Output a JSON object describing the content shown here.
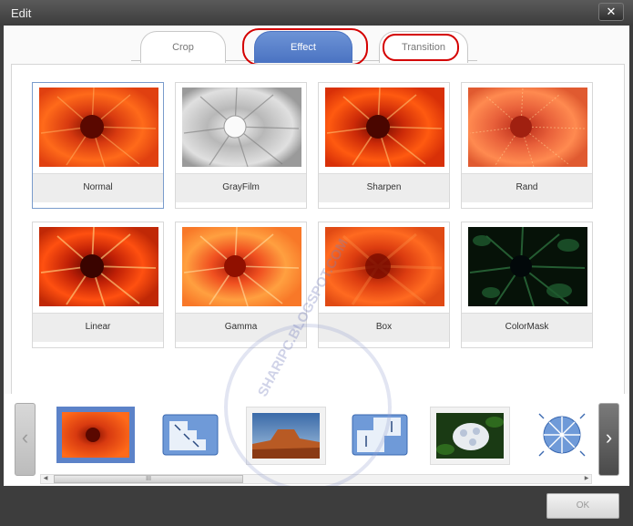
{
  "window": {
    "title": "Edit",
    "close_label": "✕"
  },
  "tabs": [
    {
      "label": "Crop",
      "active": false
    },
    {
      "label": "Effect",
      "active": true
    },
    {
      "label": "Transition",
      "active": false
    }
  ],
  "effects": [
    {
      "label": "Normal",
      "selected": true
    },
    {
      "label": "GrayFilm",
      "selected": false
    },
    {
      "label": "Sharpen",
      "selected": false
    },
    {
      "label": "Rand",
      "selected": false
    },
    {
      "label": "Linear",
      "selected": false
    },
    {
      "label": "Gamma",
      "selected": false
    },
    {
      "label": "Box",
      "selected": false
    },
    {
      "label": "ColorMask",
      "selected": false
    }
  ],
  "strip": {
    "prev_label": "‹",
    "next_label": "›",
    "scroll_grip": "III",
    "items": [
      "flower-photo",
      "transition-icon",
      "desert-photo",
      "transition-icon",
      "hydrangea-photo",
      "transition-icon"
    ]
  },
  "footer": {
    "ok_label": "OK"
  },
  "watermark": {
    "text": "SHARIPC.BLOGSPOT.COM"
  },
  "colors": {
    "accent": "#4a73c2",
    "highlight_ring": "#d40000",
    "titlebar": "#3d3d3d"
  }
}
